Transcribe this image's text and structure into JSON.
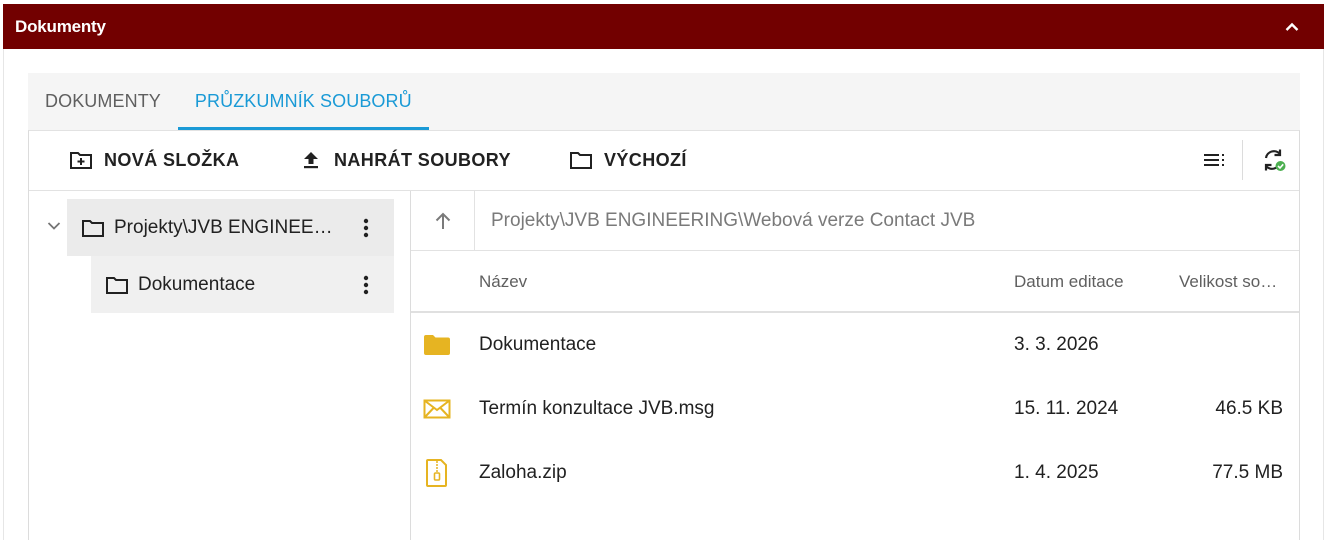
{
  "panel": {
    "title": "Dokumenty",
    "collapse_icon": "chevron-up-icon"
  },
  "tabs": [
    {
      "label": "DOKUMENTY",
      "active": false
    },
    {
      "label": "PRŮZKUMNÍK SOUBORŮ",
      "active": true
    }
  ],
  "toolbar": {
    "new_folder_label": "NOVÁ SLOŽKA",
    "upload_label": "NAHRÁT SOUBORY",
    "default_label": "VÝCHOZÍ",
    "view_icon": "list-view-icon",
    "refresh_icon": "sync-check-icon"
  },
  "tree": {
    "root": {
      "label": "Projekty\\JVB ENGINEERING",
      "expanded": true
    },
    "children": [
      {
        "label": "Dokumentace"
      }
    ]
  },
  "address": {
    "path": "Projekty\\JVB ENGINEERING\\Webová verze Contact JVB"
  },
  "columns": {
    "name": "Název",
    "date": "Datum editace",
    "size": "Velikost souboru"
  },
  "files": [
    {
      "name": "Dokumentace",
      "date": "3. 3. 2026",
      "size": "",
      "icon": "folder-icon"
    },
    {
      "name": "Termín konzultace JVB.msg",
      "date": "15. 11. 2024",
      "size": "46.5 KB",
      "icon": "mail-icon"
    },
    {
      "name": "Zaloha.zip",
      "date": "1. 4. 2025",
      "size": "77.5 MB",
      "icon": "zip-file-icon"
    }
  ],
  "colors": {
    "header": "#720000",
    "accent": "#1a9ad6",
    "file_icon": "#e6b422"
  }
}
